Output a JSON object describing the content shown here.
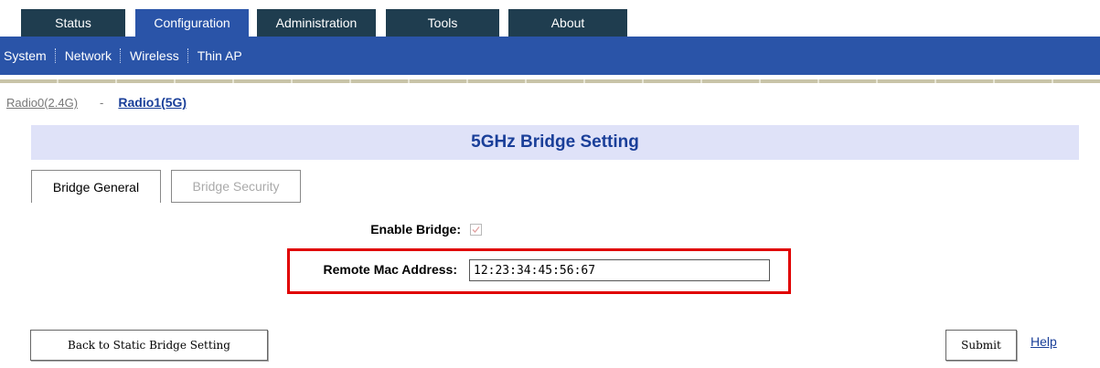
{
  "tabs": [
    {
      "label": "Status",
      "active": false
    },
    {
      "label": "Configuration",
      "active": true
    },
    {
      "label": "Administration",
      "active": false
    },
    {
      "label": "Tools",
      "active": false
    },
    {
      "label": "About",
      "active": false
    }
  ],
  "subnav": {
    "items": [
      "System",
      "Network",
      "Wireless",
      "Thin AP"
    ],
    "active": "Wireless"
  },
  "radio_links": {
    "radio0": "Radio0(2.4G)",
    "separator": "-",
    "radio1": "Radio1(5G)"
  },
  "page_title": "5GHz Bridge Setting",
  "subtabs": {
    "general": "Bridge General",
    "security": "Bridge Security"
  },
  "form": {
    "enable_label": "Enable Bridge:",
    "enable_checked": true,
    "mac_label": "Remote Mac Address:",
    "mac_value": "12:23:34:45:56:67"
  },
  "buttons": {
    "back": "Back to Static Bridge Setting",
    "submit": "Submit",
    "help": "Help"
  },
  "colors": {
    "tab_dark": "#1f3d4f",
    "nav_blue": "#2a54a8",
    "title_band": "#dfe2f8",
    "title_text": "#1a3f99",
    "highlight_red": "#e00000"
  }
}
